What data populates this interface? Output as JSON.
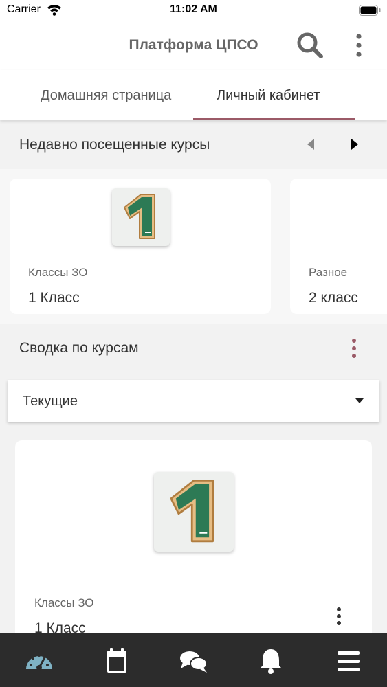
{
  "status_bar": {
    "carrier": "Carrier",
    "time": "11:02 AM",
    "icons": [
      "wifi-icon",
      "battery-icon"
    ]
  },
  "header": {
    "title": "Платформа ЦПСО",
    "icons": [
      "search-icon",
      "more-vert-icon"
    ]
  },
  "tabs": [
    {
      "label": "Домашняя страница",
      "active": false
    },
    {
      "label": "Личный кабинет",
      "active": true
    }
  ],
  "recent": {
    "title": "Недавно посещенные курсы",
    "courses": [
      {
        "category": "Классы ЗО",
        "name": "1 Класс",
        "image": "number-one-icon"
      },
      {
        "category": "Разное",
        "name": "2 класс"
      }
    ]
  },
  "summary": {
    "title": "Сводка по курсам",
    "filter": {
      "selected": "Текущие"
    },
    "courses": [
      {
        "category": "Классы ЗО",
        "name": "1 Класс",
        "image": "number-one-icon"
      }
    ]
  },
  "bottom_nav": [
    {
      "icon": "dashboard-icon",
      "active": true
    },
    {
      "icon": "calendar-icon",
      "active": false
    },
    {
      "icon": "chat-icon",
      "active": false
    },
    {
      "icon": "bell-icon",
      "active": false
    },
    {
      "icon": "menu-icon",
      "active": false
    }
  ],
  "colors": {
    "accent": "#9b5a67",
    "nav_bg": "#2c2c2c",
    "nav_active": "#7fb2c4",
    "nav_icon": "#ffffff",
    "board_green": "#2d7a55"
  }
}
